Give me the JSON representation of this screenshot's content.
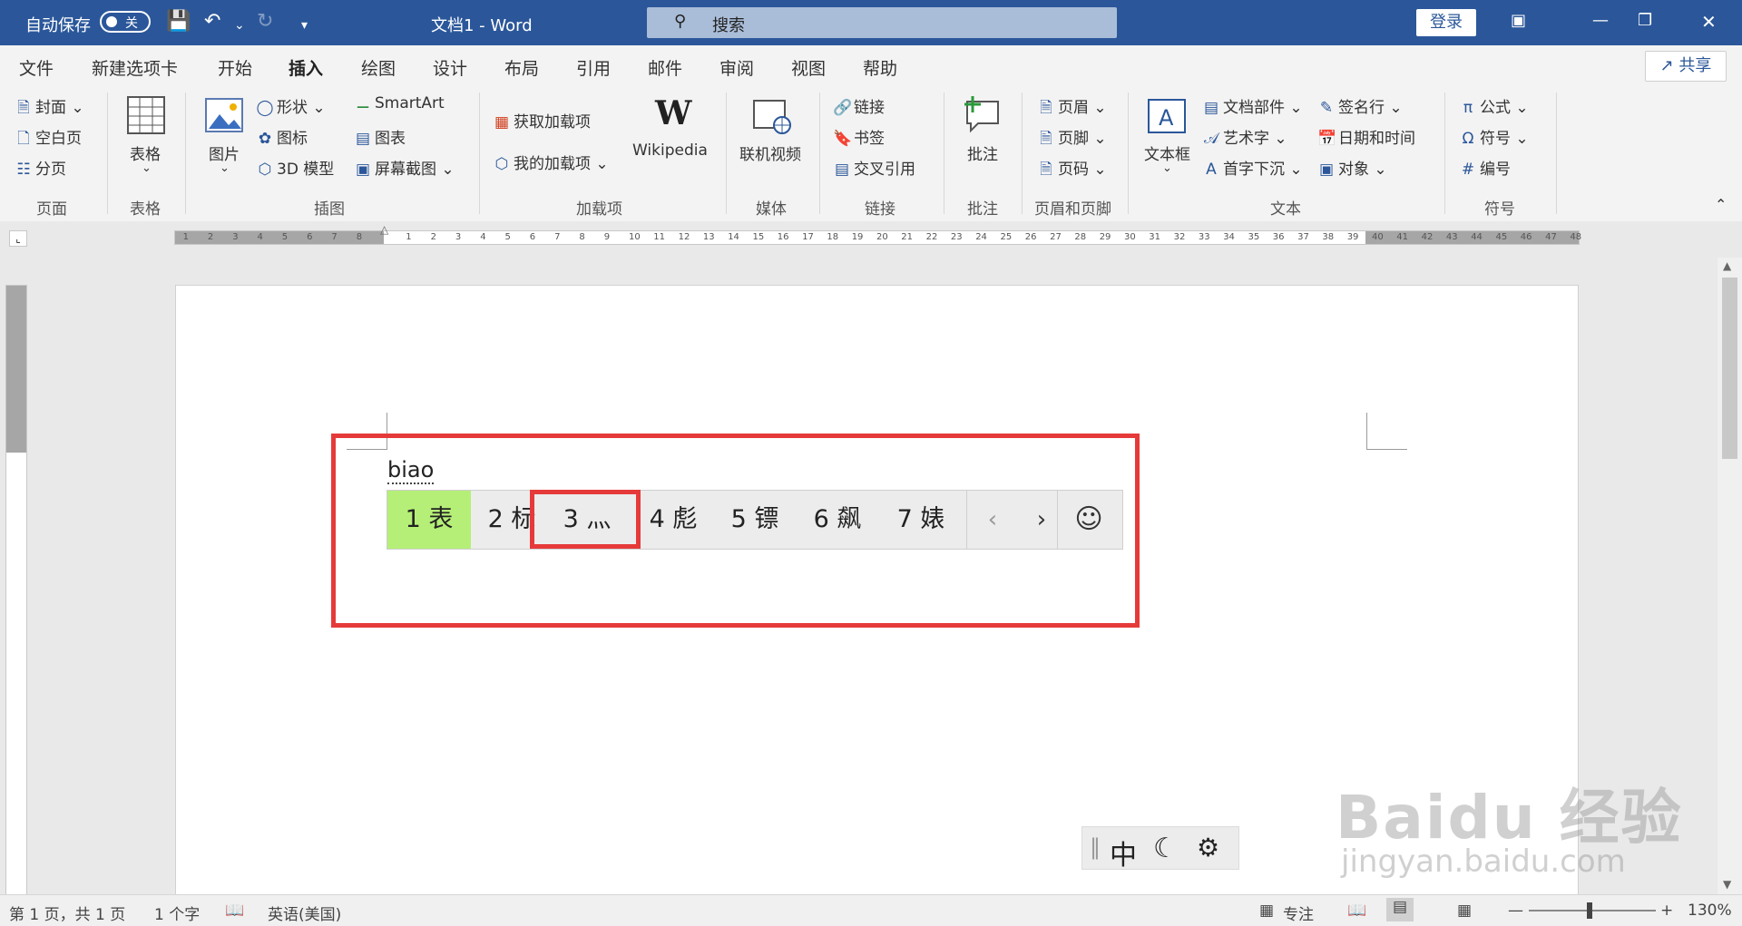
{
  "titlebar": {
    "autosave_label": "自动保存",
    "autosave_state": "关",
    "doc_title": "文档1  -  Word",
    "search_placeholder": "搜索",
    "login_label": "登录"
  },
  "menu": {
    "items": [
      "文件",
      "新建选项卡",
      "开始",
      "插入",
      "绘图",
      "设计",
      "布局",
      "引用",
      "邮件",
      "审阅",
      "视图",
      "帮助"
    ],
    "active": "插入",
    "share_label": "共享"
  },
  "ribbon": {
    "page": {
      "cover": "封面",
      "blank": "空白页",
      "break": "分页",
      "group": "页面"
    },
    "table": {
      "table": "表格",
      "group": "表格"
    },
    "illus": {
      "picture": "图片",
      "shapes": "形状",
      "icons": "图标",
      "model3d": "3D 模型",
      "smartart": "SmartArt",
      "chart": "图表",
      "screenshot": "屏幕截图",
      "group": "插图"
    },
    "addins": {
      "get": "获取加载项",
      "mine": "我的加载项",
      "wikipedia": "Wikipedia",
      "group": "加载项"
    },
    "media": {
      "video": "联机视频",
      "group": "媒体"
    },
    "links": {
      "link": "链接",
      "bookmark": "书签",
      "crossref": "交叉引用",
      "group": "链接"
    },
    "comments": {
      "comment": "批注",
      "group": "批注"
    },
    "headfoot": {
      "header": "页眉",
      "footer": "页脚",
      "pagenum": "页码",
      "group": "页眉和页脚"
    },
    "text": {
      "textbox": "文本框",
      "quickparts": "文档部件",
      "wordart": "艺术字",
      "dropcap": "首字下沉",
      "sigline": "签名行",
      "datetime": "日期和时间",
      "object": "对象",
      "group": "文本"
    },
    "symbols": {
      "equation": "公式",
      "symbol": "符号",
      "number": "编号",
      "group": "符号"
    }
  },
  "ruler": {
    "left_numbers": [
      "8",
      "7",
      "6",
      "5",
      "4",
      "3",
      "2",
      "1"
    ],
    "right_numbers": [
      "1",
      "2",
      "3",
      "4",
      "5",
      "6",
      "7",
      "8",
      "9",
      "10",
      "11",
      "12",
      "13",
      "14",
      "15",
      "16",
      "17",
      "18",
      "19",
      "20",
      "21",
      "22",
      "23",
      "24",
      "25",
      "26",
      "27",
      "28",
      "29",
      "30",
      "31",
      "32",
      "33",
      "34",
      "35",
      "36",
      "37",
      "38",
      "39",
      "40",
      "41",
      "42",
      "43",
      "44",
      "45",
      "46",
      "47",
      "48"
    ]
  },
  "ime": {
    "pinyin": "biao",
    "candidates": [
      {
        "num": "1",
        "text": "表"
      },
      {
        "num": "2",
        "text": "标"
      },
      {
        "num": "3",
        "text": "灬"
      },
      {
        "num": "4",
        "text": "彪"
      },
      {
        "num": "5",
        "text": "镖"
      },
      {
        "num": "6",
        "text": "飙"
      },
      {
        "num": "7",
        "text": "婊"
      }
    ],
    "prev": "‹",
    "next": "›",
    "emoji": "☺",
    "bar": {
      "mode": "中",
      "moon": "☾",
      "gear": "⚙"
    }
  },
  "status": {
    "page": "第 1 页，共 1 页",
    "words": "1 个字",
    "lang": "英语(美国)",
    "focus": "专注",
    "zoom": "130%"
  },
  "watermark": {
    "line1": "Baidu 经验",
    "line2": "jingyan.baidu.com"
  },
  "colors": {
    "accent": "#2b579a",
    "highlight": "#b5ef77",
    "annotation": "#e63a3a"
  }
}
